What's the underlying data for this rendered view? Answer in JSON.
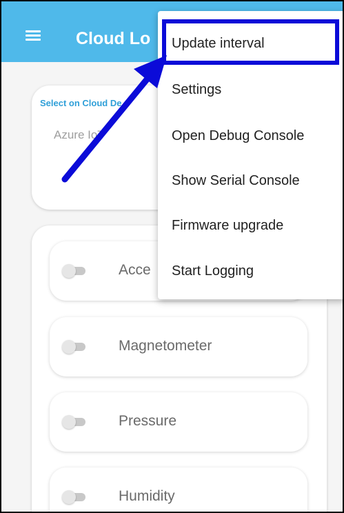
{
  "app": {
    "title": "Cloud Lo"
  },
  "select_card": {
    "label": "Select on Cloud De",
    "value": "Azure IoT"
  },
  "sensors": [
    {
      "label": "Acce",
      "enabled": false
    },
    {
      "label": "Magnetometer",
      "enabled": false
    },
    {
      "label": "Pressure",
      "enabled": false
    },
    {
      "label": "Humidity",
      "enabled": false
    }
  ],
  "menu": {
    "items": [
      {
        "label": "Update interval",
        "highlighted": true
      },
      {
        "label": "Settings"
      },
      {
        "label": "Open Debug Console"
      },
      {
        "label": "Show Serial Console"
      },
      {
        "label": "Firmware upgrade"
      },
      {
        "label": "Start Logging"
      }
    ]
  },
  "colors": {
    "toolbar": "#4fb9ea",
    "annotation": "#0b0bd8",
    "label_accent": "#2f9fd8"
  }
}
